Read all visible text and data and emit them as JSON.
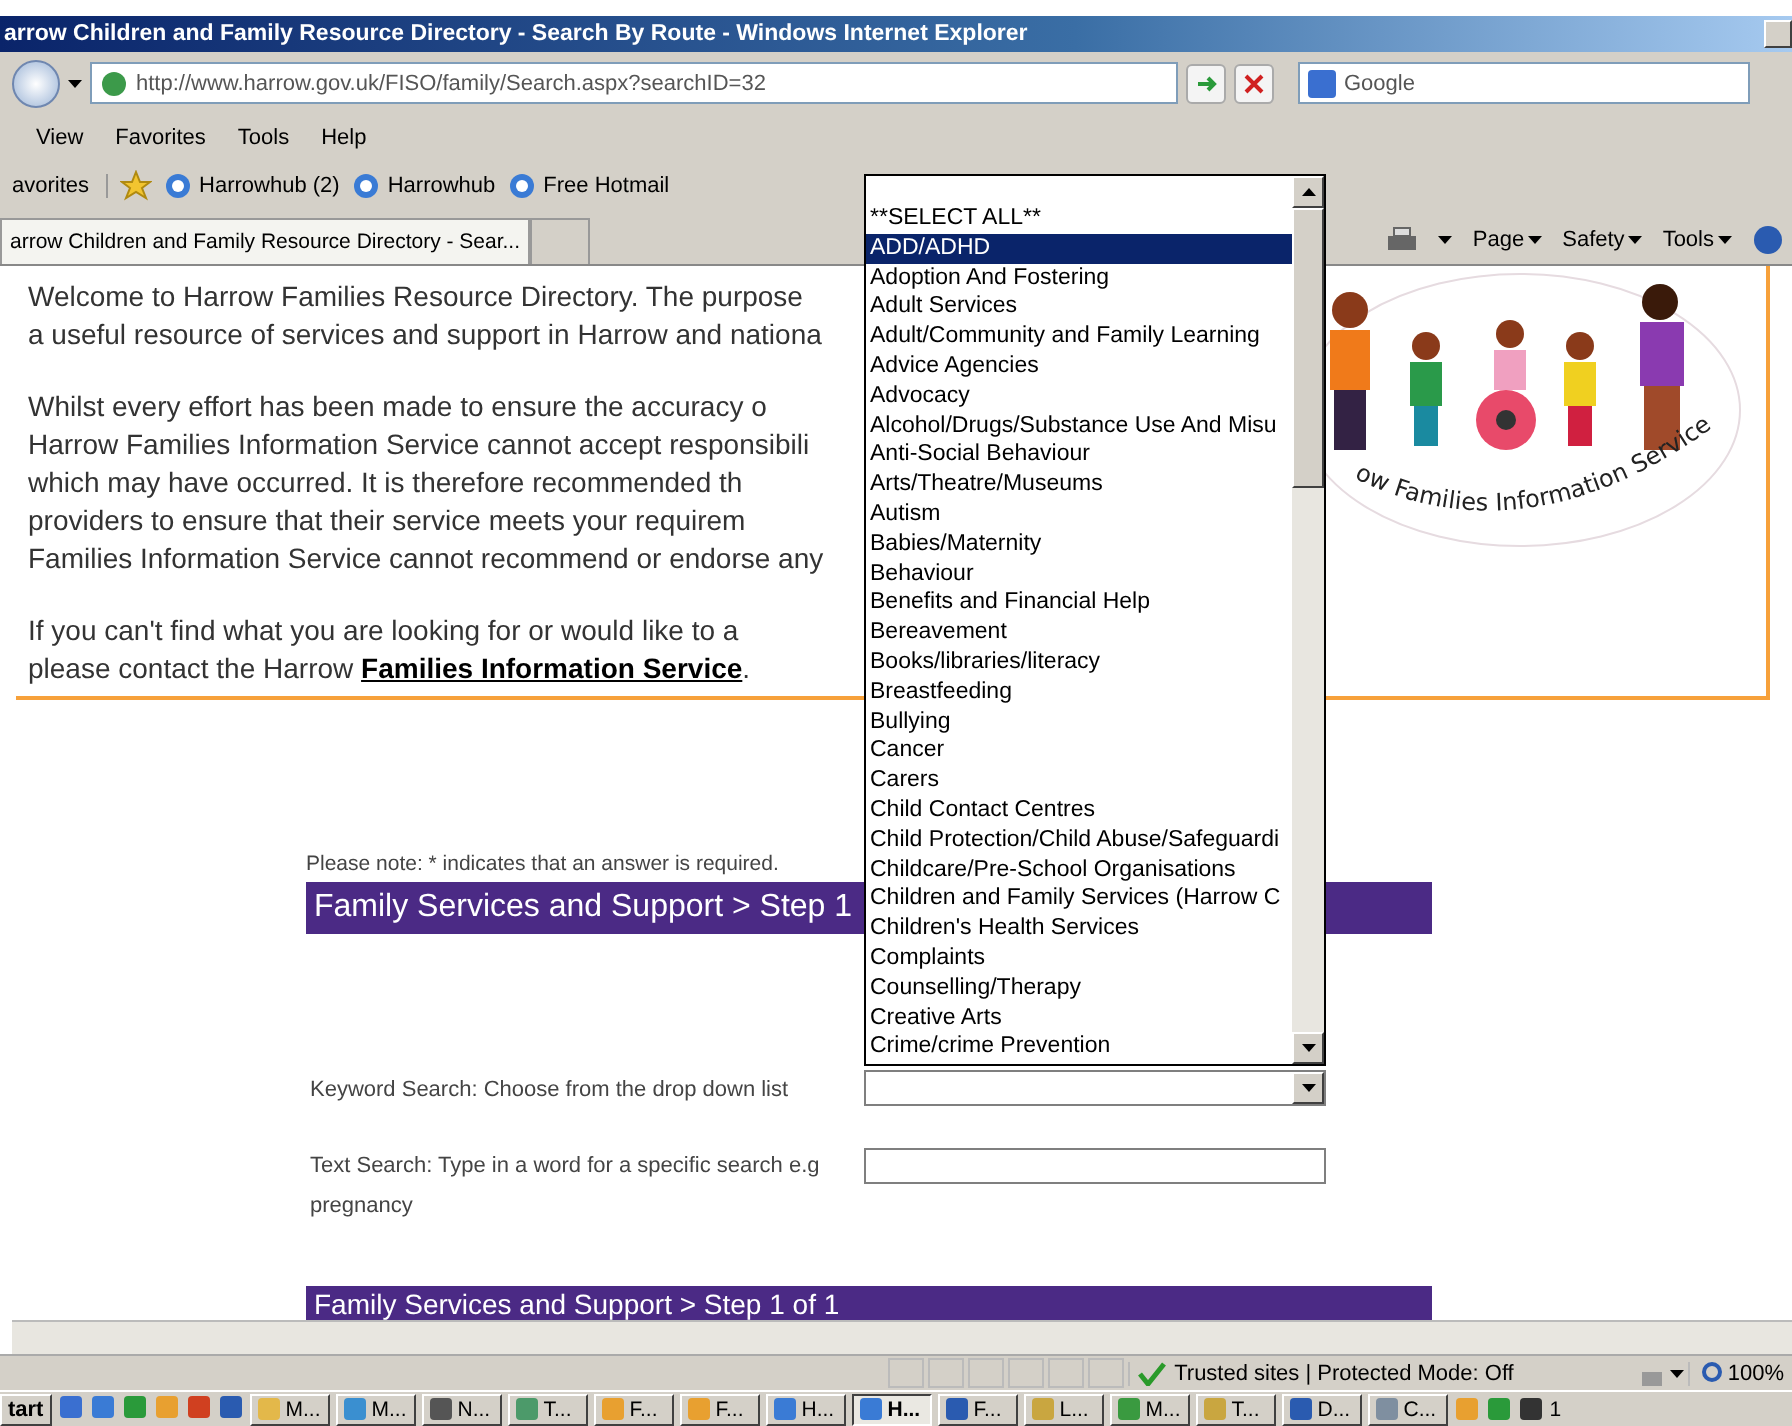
{
  "window": {
    "title": "arrow Children and Family Resource Directory - Search By Route - Windows Internet Explorer"
  },
  "address_bar": {
    "url": "http://www.harrow.gov.uk/FISO/family/Search.aspx?searchID=32",
    "search_placeholder": "Google"
  },
  "menu": [
    "View",
    "Favorites",
    "Tools",
    "Help"
  ],
  "favorites_bar": {
    "label": "avorites",
    "links": [
      "Harrowhub (2)",
      "Harrowhub",
      "Free Hotmail"
    ]
  },
  "tabs": [
    {
      "label": "arrow Children and Family Resource Directory - Sear...",
      "selected": true
    },
    {
      "selected": false
    }
  ],
  "command_bar": [
    "Page",
    "Safety",
    "Tools"
  ],
  "intro": {
    "paragraphs": [
      [
        "Welcome to Harrow Families Resource Directory. The purpose",
        "a useful resource of services and support in Harrow and nationa"
      ],
      [
        "Whilst every effort has been made to ensure the accuracy o",
        "Harrow Families Information Service cannot accept responsibili",
        "which may have occurred. It is therefore recommended th",
        "providers to ensure that their service meets your requirem",
        "Families Information Service cannot recommend or endorse any"
      ]
    ],
    "contact": {
      "lines": [
        "If you can't find what you are looking for or would like to a",
        "please contact the Harrow "
      ],
      "link": "Families Information Service",
      "after": "."
    },
    "logo_caption": "ow Families Information Service"
  },
  "form": {
    "note": "Please note: * indicates that an answer is required.",
    "header": "Family Services and Support > Step 1",
    "keyword_label": "Keyword Search: Choose from the drop down list",
    "text_label": "Text Search: Type in a word for a specific search e.g pregnancy",
    "footer_header": "Family Services and Support > Step 1 of 1"
  },
  "dropdown": {
    "options": [
      {
        "label": "**SELECT ALL**",
        "selected": false
      },
      {
        "label": "ADD/ADHD",
        "selected": true
      },
      {
        "label": "Adoption And Fostering",
        "selected": false
      },
      {
        "label": "Adult Services",
        "selected": false
      },
      {
        "label": "Adult/Community and Family Learning",
        "selected": false
      },
      {
        "label": "Advice Agencies",
        "selected": false
      },
      {
        "label": "Advocacy",
        "selected": false
      },
      {
        "label": "Alcohol/Drugs/Substance Use And Misu",
        "selected": false
      },
      {
        "label": "Anti-Social Behaviour",
        "selected": false
      },
      {
        "label": "Arts/Theatre/Museums",
        "selected": false
      },
      {
        "label": "Autism",
        "selected": false
      },
      {
        "label": "Babies/Maternity",
        "selected": false
      },
      {
        "label": "Behaviour",
        "selected": false
      },
      {
        "label": "Benefits and Financial Help",
        "selected": false
      },
      {
        "label": "Bereavement",
        "selected": false
      },
      {
        "label": "Books/libraries/literacy",
        "selected": false
      },
      {
        "label": "Breastfeeding",
        "selected": false
      },
      {
        "label": "Bullying",
        "selected": false
      },
      {
        "label": "Cancer",
        "selected": false
      },
      {
        "label": "Carers",
        "selected": false
      },
      {
        "label": "Child Contact Centres",
        "selected": false
      },
      {
        "label": "Child Protection/Child Abuse/Safeguardi",
        "selected": false
      },
      {
        "label": "Childcare/Pre-School Organisations",
        "selected": false
      },
      {
        "label": "Children and Family Services (Harrow C",
        "selected": false
      },
      {
        "label": "Children's Health Services",
        "selected": false
      },
      {
        "label": "Complaints",
        "selected": false
      },
      {
        "label": "Counselling/Therapy",
        "selected": false
      },
      {
        "label": "Creative Arts",
        "selected": false
      },
      {
        "label": "Crime/crime Prevention",
        "selected": false
      }
    ]
  },
  "status_bar": {
    "zone": "Trusted sites | Protected Mode: Off",
    "zoom": "100%"
  },
  "taskbar": {
    "start": "tart",
    "buttons": [
      {
        "label": "M...",
        "selected": false
      },
      {
        "label": "M...",
        "selected": false
      },
      {
        "label": "N...",
        "selected": false
      },
      {
        "label": "T...",
        "selected": false
      },
      {
        "label": "F...",
        "selected": false
      },
      {
        "label": "F...",
        "selected": false
      },
      {
        "label": "H...",
        "selected": false
      },
      {
        "label": "H...",
        "selected": true
      },
      {
        "label": "F...",
        "selected": false
      },
      {
        "label": "L...",
        "selected": false
      },
      {
        "label": "M...",
        "selected": false
      },
      {
        "label": "T...",
        "selected": false
      },
      {
        "label": "D...",
        "selected": false
      },
      {
        "label": "C...",
        "selected": false
      }
    ],
    "clock": "1"
  }
}
